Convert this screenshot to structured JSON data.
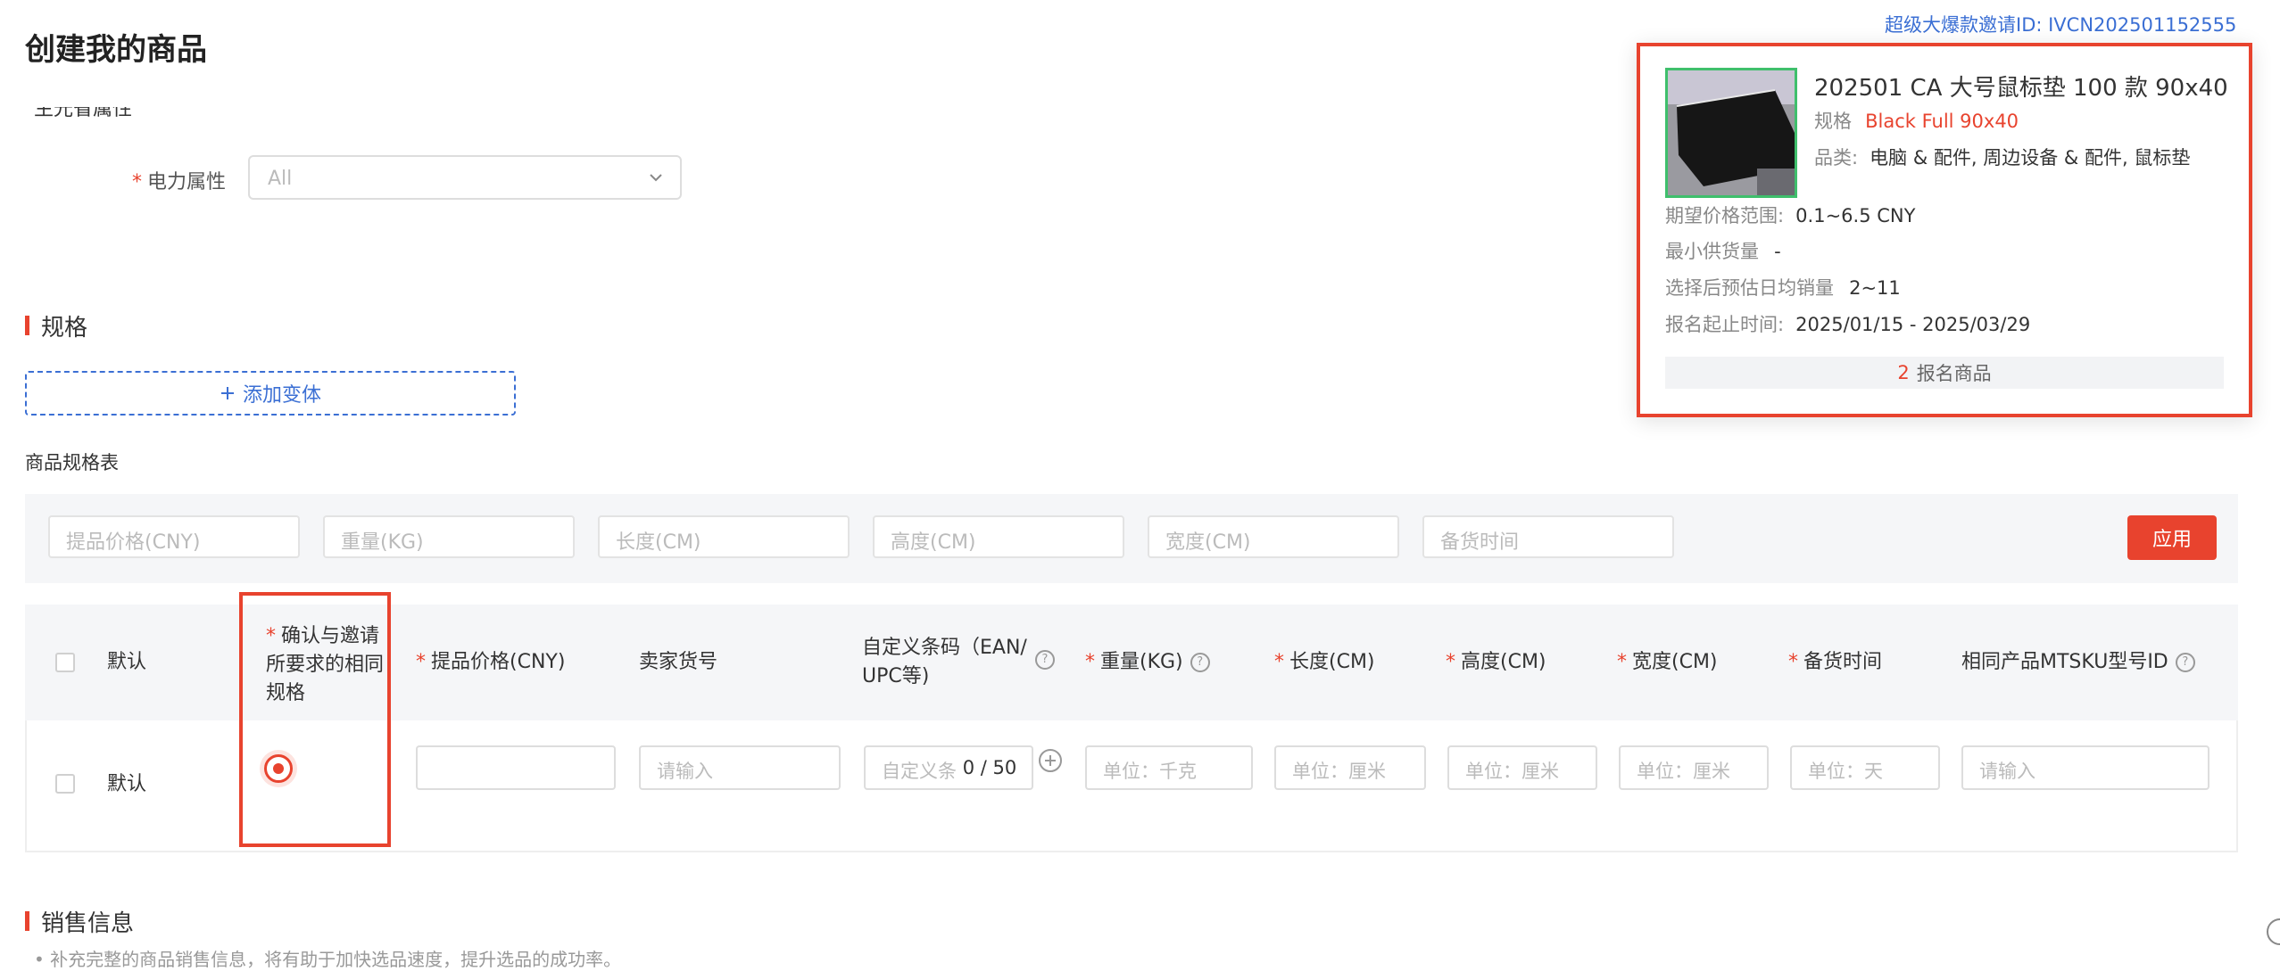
{
  "header": {
    "title": "创建我的商品",
    "cut_off_text": "生光省属性"
  },
  "form": {
    "required_mark": "*",
    "power_label": "电力属性",
    "power_value": "All"
  },
  "spec_section": {
    "title": "规格",
    "add_variant_label": "添加变体",
    "table_title": "商品规格表",
    "apply_label": "应用",
    "filter_placeholders": [
      "提品价格(CNY)",
      "重量(KG)",
      "长度(CM)",
      "高度(CM)",
      "宽度(CM)",
      "备货时间"
    ]
  },
  "table": {
    "headers": {
      "default": "默认",
      "confirm_line1": "确认与邀请",
      "confirm_line2": "所要求的相同",
      "confirm_line3": "规格",
      "price": "提品价格(CNY)",
      "sku": "卖家货号",
      "barcode_line1": "自定义条码（EAN/",
      "barcode_line2": "UPC等)",
      "weight": "重量(KG)",
      "length": "长度(CM)",
      "height": "高度(CM)",
      "width": "宽度(CM)",
      "stock_time": "备货时间",
      "mtsku": "相同产品MTSKU型号ID"
    },
    "row": {
      "label": "默认",
      "sku_placeholder": "请输入",
      "barcode_placeholder": "自定义条码",
      "barcode_count": "0 / 50",
      "weight_placeholder": "单位：千克",
      "length_placeholder": "单位：厘米",
      "height_placeholder": "单位：厘米",
      "width_placeholder": "单位：厘米",
      "stock_placeholder": "单位：天",
      "mtsku_placeholder": "请输入"
    }
  },
  "sales_section": {
    "title": "销售信息",
    "note": "补充完整的商品销售信息，将有助于加快选品速度，提升选品的成功率。"
  },
  "invite_popup": {
    "invite_id": "超级大爆款邀请ID: IVCN202501152555",
    "product_title": "202501 CA 大号鼠标垫 100 款 90x40...",
    "spec_label": "规格",
    "spec_value": "Black Full 90x40",
    "category_label": "品类:",
    "category_value": "电脑 & 配件, 周边设备 & 配件, 鼠标垫",
    "price_range_label": "期望价格范围:",
    "price_range_value": "0.1~6.5 CNY",
    "min_supply_label": "最小供货量",
    "min_supply_value": "-",
    "est_sales_label": "选择后预估日均销量",
    "est_sales_value": "2~11",
    "period_label": "报名起止时间:",
    "period_value": "2025/01/15 - 2025/03/29",
    "registered_count": "2",
    "registered_label": "报名商品"
  },
  "colors": {
    "accent_red": "#e8432e",
    "link_blue": "#3b6fd4",
    "thumb_border_green": "#3fbf6c"
  }
}
